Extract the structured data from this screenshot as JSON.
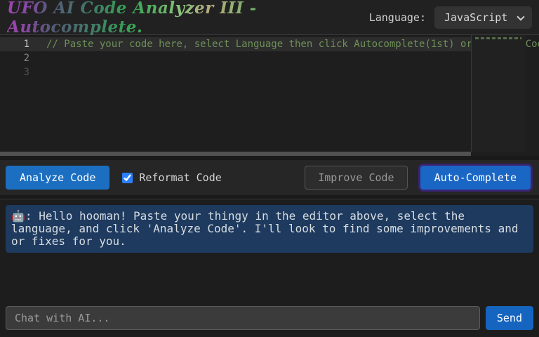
{
  "header": {
    "title": "UFO AI Code Analyzer III - Autocomplete.",
    "language_label": "Language:",
    "language_selected": "JavaScript"
  },
  "editor": {
    "lines": [
      {
        "number": "1",
        "code": "// Paste your code here, select Language then click Autocomplete(1st) or Analyze Code"
      },
      {
        "number": "2",
        "code": ""
      },
      {
        "number": "3",
        "code": ""
      }
    ],
    "comment_color": "#6d9158",
    "active_line": 1
  },
  "toolbar": {
    "analyze_label": "Analyze Code",
    "reformat_label": "Reformat Code",
    "reformat_checked": true,
    "improve_label": "Improve Code",
    "autocomplete_label": "Auto-Complete"
  },
  "chat": {
    "ai_message": "🤖: Hello hooman! Paste your thingy in the editor above, select the language, and click 'Analyze Code'. I'll look to find some improvements and or fixes for you.",
    "input_value": "",
    "input_placeholder": "Chat with AI...",
    "send_label": "Send"
  },
  "colors": {
    "page_background": "#1a1a1a",
    "header_background": "#212121",
    "editor_background": "#1e1e1e",
    "active_line_background": "#2d2d2d",
    "comment_green": "#6d9158",
    "toolbar_background": "#262626",
    "analyze_button_blue": "#1c6fc0",
    "autocomplete_button_blue": "#1a66c4",
    "autocomplete_focus_ring": "#3a2470",
    "checkbox_blue": "#2a7fff",
    "message_bubble_blue": "#1e3a5e",
    "send_button_blue": "#1565c0",
    "input_background": "#3b3b3b"
  }
}
